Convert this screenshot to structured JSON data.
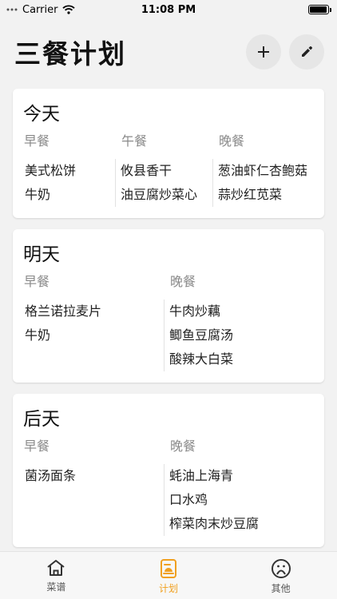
{
  "status": {
    "carrier": "Carrier",
    "time": "11:08 PM",
    "battery_level": 0.95
  },
  "header": {
    "title": "三餐计划",
    "add_icon": "plus-icon",
    "edit_icon": "pencil-icon"
  },
  "days": [
    {
      "title": "今天",
      "meals": [
        {
          "label": "早餐",
          "dishes": [
            "美式松饼",
            "牛奶"
          ]
        },
        {
          "label": "午餐",
          "dishes": [
            "攸县香干",
            "油豆腐炒菜心"
          ]
        },
        {
          "label": "晚餐",
          "dishes": [
            "葱油虾仁杏鲍菇",
            "蒜炒红苋菜"
          ]
        }
      ]
    },
    {
      "title": "明天",
      "meals": [
        {
          "label": "早餐",
          "dishes": [
            "格兰诺拉麦片",
            "牛奶"
          ]
        },
        {
          "label": "晚餐",
          "dishes": [
            "牛肉炒藕",
            "鲫鱼豆腐汤",
            "酸辣大白菜"
          ]
        }
      ]
    },
    {
      "title": "后天",
      "meals": [
        {
          "label": "早餐",
          "dishes": [
            "菌汤面条"
          ]
        },
        {
          "label": "晚餐",
          "dishes": [
            "蚝油上海青",
            "口水鸡",
            "榨菜肉末炒豆腐"
          ]
        }
      ]
    }
  ],
  "tabs": [
    {
      "label": "菜谱",
      "icon": "home-icon",
      "active": false
    },
    {
      "label": "计划",
      "icon": "plan-icon",
      "active": true
    },
    {
      "label": "其他",
      "icon": "face-icon",
      "active": false
    }
  ],
  "colors": {
    "accent": "#f0a020",
    "background": "#f2f2f2",
    "card": "#ffffff",
    "muted": "#8a8a8a"
  }
}
